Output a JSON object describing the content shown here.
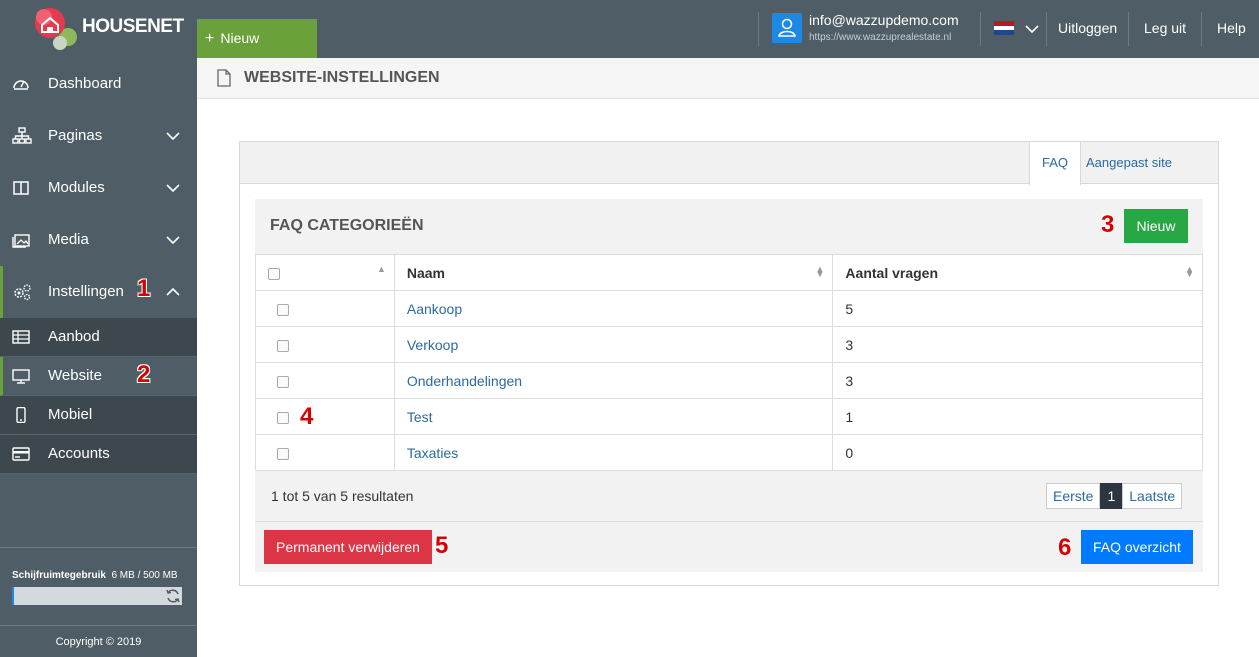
{
  "brand": {
    "name": "HOUSENET"
  },
  "topbar": {
    "new_button": "Nieuw",
    "user_email": "info@wazzupdemo.com",
    "user_site": "https://www.wazzuprealestate.nl",
    "logout1": "Uitloggen",
    "logout2": "Leg uit",
    "help": "Help",
    "flag_colors": [
      "#ae1c28",
      "#ffffff",
      "#21468b"
    ]
  },
  "sidebar": {
    "items": [
      {
        "label": "Dashboard",
        "icon": "dashboard-icon"
      },
      {
        "label": "Paginas",
        "icon": "sitemap-icon"
      },
      {
        "label": "Modules",
        "icon": "columns-icon"
      },
      {
        "label": "Media",
        "icon": "image-icon"
      },
      {
        "label": "Instellingen",
        "icon": "cogs-icon"
      }
    ],
    "subitems": [
      {
        "label": "Aanbod",
        "icon": "table-icon"
      },
      {
        "label": "Website",
        "icon": "monitor-icon"
      },
      {
        "label": "Mobiel",
        "icon": "mobile-icon"
      },
      {
        "label": "Accounts",
        "icon": "card-icon"
      }
    ],
    "disk_label": "Schijfruimtegebruik",
    "disk_value": "6 MB / 500 MB",
    "disk_fraction": 0.012,
    "copyright": "Copyright © 2019"
  },
  "page": {
    "title": "WEBSITE-INSTELLINGEN"
  },
  "tabs": [
    {
      "label": "FAQ"
    },
    {
      "label": "Aangepast site script"
    }
  ],
  "faq": {
    "title": "FAQ CATEGORIEËN",
    "new_button": "Nieuw",
    "columns": [
      "Naam",
      "Aantal vragen"
    ],
    "rows": [
      {
        "name": "Aankoop",
        "count": "5"
      },
      {
        "name": "Verkoop",
        "count": "3"
      },
      {
        "name": "Onderhandelingen",
        "count": "3"
      },
      {
        "name": "Test",
        "count": "1"
      },
      {
        "name": "Taxaties",
        "count": "0"
      }
    ],
    "result_info": "1 tot 5 van 5 resultaten",
    "pager": {
      "first": "Eerste",
      "current": "1",
      "last": "Laatste"
    },
    "delete_button": "Permanent verwijderen",
    "overview_button": "FAQ overzicht"
  },
  "annotations": [
    "1",
    "2",
    "3",
    "4",
    "5",
    "6"
  ],
  "colors": {
    "sidebar": "#4f5e66",
    "accent_green": "#6aa13a",
    "danger": "#dc3545",
    "primary": "#007bff",
    "success": "#28a745",
    "link": "#2c6aa0",
    "annotation": "#d90000"
  }
}
